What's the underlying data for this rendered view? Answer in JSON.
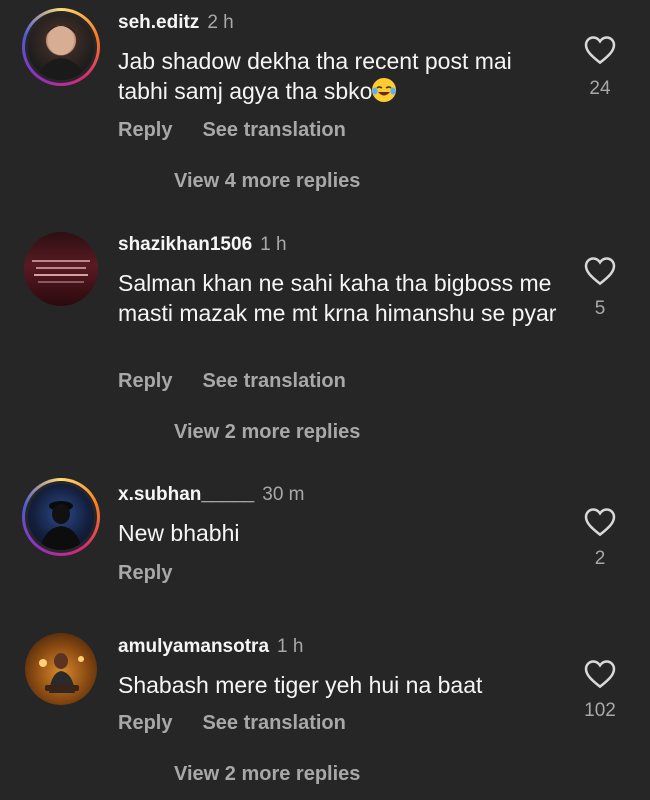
{
  "comments": [
    {
      "username": "seh.editz",
      "time": "2 h",
      "text": "Jab shadow dekha tha recent post mai tabhi samj agya tha sbko",
      "emoji": "face-with-tears-of-joy-emoji",
      "reply_label": "Reply",
      "translate_label": "See translation",
      "likes": "24",
      "more_replies": "View 4 more replies"
    },
    {
      "username": "shazikhan1506",
      "time": "1 h",
      "text": "Salman khan ne sahi kaha tha bigboss me masti mazak me mt krna himanshu se pyar",
      "reply_label": "Reply",
      "translate_label": "See translation",
      "likes": "5",
      "more_replies": "View 2 more replies"
    },
    {
      "username": "x.subhan_____",
      "time": "30 m",
      "text": "New bhabhi",
      "reply_label": "Reply",
      "likes": "2"
    },
    {
      "username": "amulyamansotra",
      "time": "1 h",
      "text": "Shabash mere tiger yeh hui na baat",
      "reply_label": "Reply",
      "translate_label": "See translation",
      "likes": "102",
      "more_replies": "View 2 more replies"
    }
  ],
  "colors": {
    "background": "#262626",
    "primary_text": "#f5f5f5",
    "secondary_text": "#a8a8a8",
    "story_ring": "#d62976"
  }
}
